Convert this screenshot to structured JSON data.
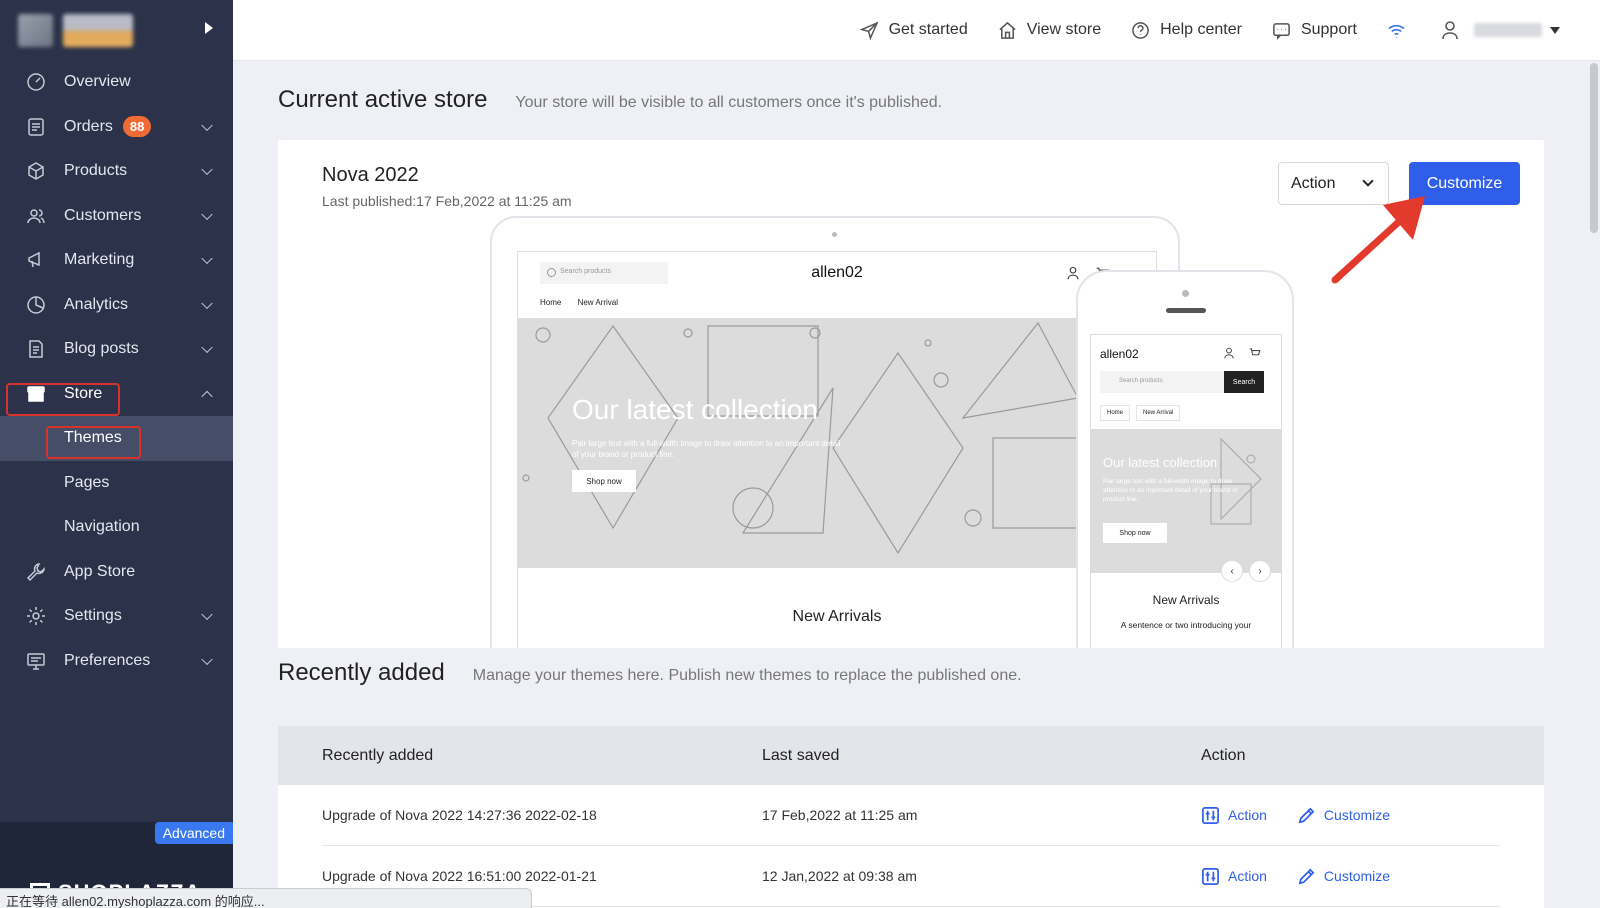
{
  "sidebar": {
    "items": [
      {
        "label": "Overview"
      },
      {
        "label": "Orders",
        "badge": "88"
      },
      {
        "label": "Products"
      },
      {
        "label": "Customers"
      },
      {
        "label": "Marketing"
      },
      {
        "label": "Analytics"
      },
      {
        "label": "Blog posts"
      },
      {
        "label": "Store"
      }
    ],
    "store_sub": [
      {
        "label": "Themes"
      },
      {
        "label": "Pages"
      },
      {
        "label": "Navigation"
      }
    ],
    "items_after": [
      {
        "label": "App Store"
      },
      {
        "label": "Settings"
      },
      {
        "label": "Preferences"
      }
    ],
    "plan_tag": "Advanced",
    "brand": "SHOPLAZZA"
  },
  "topbar": {
    "get_started": "Get started",
    "view_store": "View store",
    "help_center": "Help center",
    "support": "Support"
  },
  "current": {
    "title": "Current active store",
    "desc": "Your store will be visible to all customers once it's published.",
    "theme_name": "Nova 2022",
    "last_published": "Last published:17 Feb,2022 at 11:25 am",
    "action_label": "Action",
    "customize_label": "Customize"
  },
  "preview": {
    "search_placeholder": "Search products",
    "brand": "allen02",
    "nav": [
      "Home",
      "New Arrival"
    ],
    "hero_title": "Our latest collection",
    "hero_sub": "Pair large text with a full-width image to draw attention to an important detail of your brand or product line.",
    "hero_btn": "Shop now",
    "new_arrivals": "New Arrivals",
    "phone_search_btn": "Search",
    "phone_sub": "A sentence or two introducing your"
  },
  "recent": {
    "title": "Recently added",
    "desc": "Manage your themes here. Publish new themes to replace the published one.",
    "columns": [
      "Recently added",
      "Last saved",
      "Action"
    ],
    "rows": [
      {
        "name": "Upgrade of Nova 2022 14:27:36 2022-02-18",
        "saved": "17 Feb,2022 at 11:25 am",
        "action": "Action",
        "customize": "Customize"
      },
      {
        "name": "Upgrade of Nova 2022 16:51:00 2022-01-21",
        "saved": "12 Jan,2022 at 09:38 am",
        "action": "Action",
        "customize": "Customize"
      }
    ]
  },
  "statusbar": "正在等待 allen02.myshoplazza.com 的响应...",
  "colors": {
    "sidebar": "#2b3249",
    "accent": "#2f5fea",
    "highlight": "#d9322b",
    "badge": "#f06a35"
  }
}
